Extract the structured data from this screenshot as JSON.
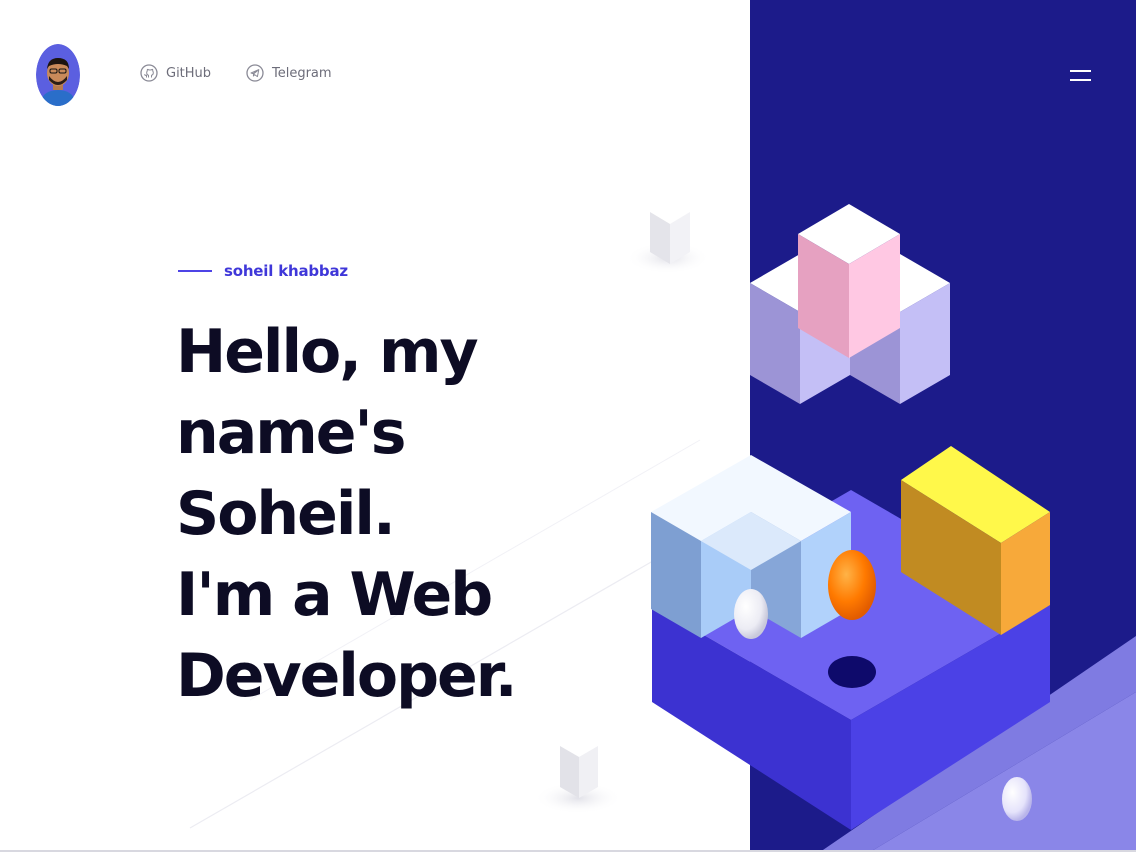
{
  "header": {
    "avatar_alt": "avatar",
    "links": [
      {
        "label": "GitHub",
        "icon": "github-icon"
      },
      {
        "label": "Telegram",
        "icon": "telegram-icon"
      }
    ],
    "menu_icon": "hamburger-menu-icon"
  },
  "hero": {
    "eyebrow": "soheil khabbaz",
    "headline_lines": [
      "Hello, my",
      "name's",
      "Soheil.",
      "I'm a Web",
      "Developer."
    ]
  },
  "colors": {
    "accent": "#3f37d9",
    "panel": "#1c1b8a",
    "text": "#0d0c24"
  }
}
